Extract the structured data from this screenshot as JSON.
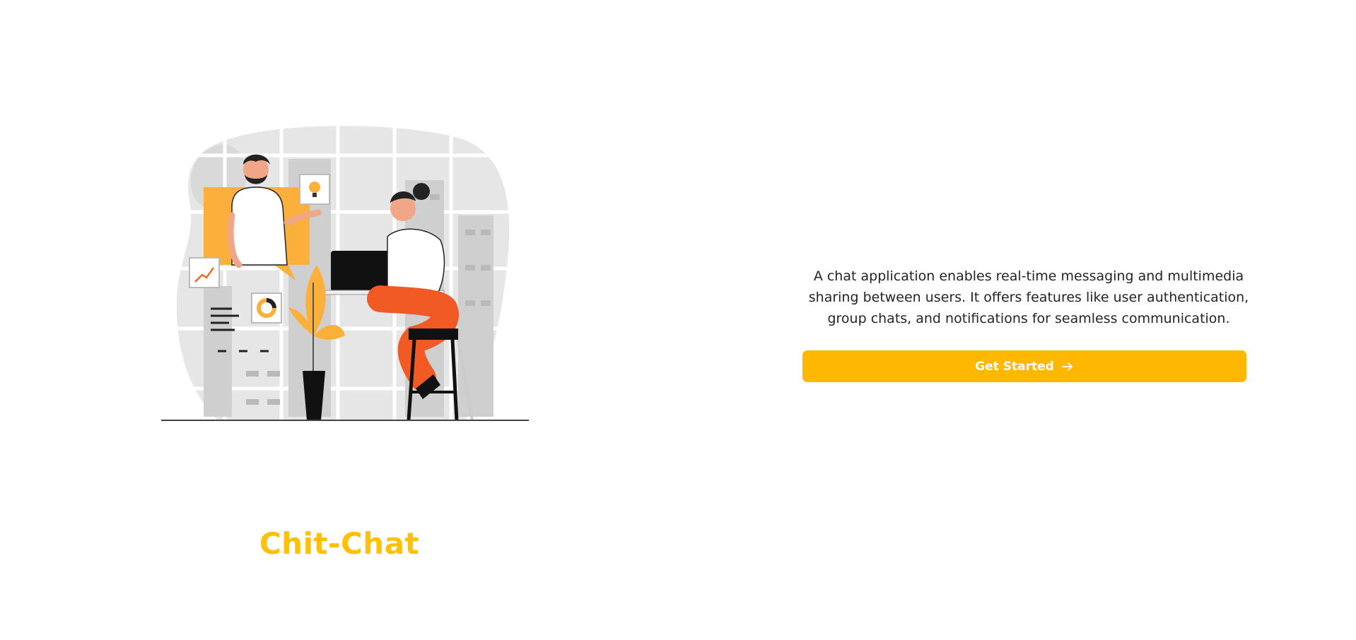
{
  "hero": {
    "illustration_icon": "two-people-chatting-illustration",
    "title": "Chit-Chat",
    "title_color": "#ffc107"
  },
  "intro": {
    "description": "A chat application enables real-time messaging and multimedia sharing between users. It offers features like user authentication, group chats, and notifications for seamless communication.",
    "button_label": "Get Started",
    "button_icon": "arrow-right-icon",
    "button_color": "#ffb800"
  }
}
